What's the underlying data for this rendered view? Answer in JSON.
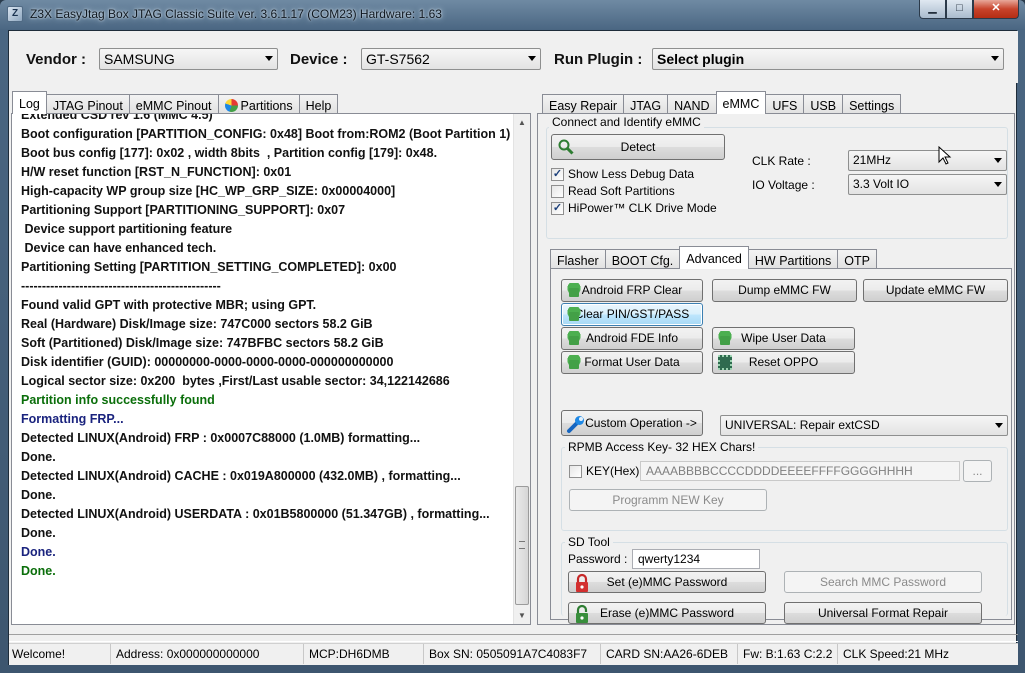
{
  "window": {
    "title": "Z3X EasyJtag Box JTAG Classic Suite ver. 3.6.1.17 (COM23) Hardware: 1.63",
    "controls": {
      "minimize": "▁",
      "maximize": "□",
      "close": "✕"
    }
  },
  "topbar": {
    "vendor_label": "Vendor :",
    "vendor_value": "SAMSUNG",
    "device_label": "Device :",
    "device_value": "GT-S7562",
    "plugin_label": "Run Plugin :",
    "plugin_value": "Select plugin"
  },
  "left_tabs": [
    "Log",
    "JTAG Pinout",
    "eMMC Pinout",
    "Partitions",
    "Help"
  ],
  "log_lines": [
    {
      "text": "Extended CSD rev 1.6 (MMC 4.5)",
      "color": "#111111"
    },
    {
      "text": "Boot configuration [PARTITION_CONFIG: 0x48] Boot from:ROM2 (Boot Partition 1)",
      "color": "#111111"
    },
    {
      "text": "Boot bus config [177]: 0x02 , width 8bits  , Partition config [179]: 0x48.",
      "color": "#111111"
    },
    {
      "text": "H/W reset function [RST_N_FUNCTION]: 0x01",
      "color": "#111111"
    },
    {
      "text": "High-capacity WP group size [HC_WP_GRP_SIZE: 0x00004000]",
      "color": "#111111"
    },
    {
      "text": "Partitioning Support [PARTITIONING_SUPPORT]: 0x07",
      "color": "#111111"
    },
    {
      "text": " Device support partitioning feature",
      "color": "#111111"
    },
    {
      "text": " Device can have enhanced tech.",
      "color": "#111111"
    },
    {
      "text": "Partitioning Setting [PARTITION_SETTING_COMPLETED]: 0x00",
      "color": "#111111"
    },
    {
      "text": "------------------------------------------------",
      "color": "#111111"
    },
    {
      "text": "Found valid GPT with protective MBR; using GPT.",
      "color": "#111111"
    },
    {
      "text": "Real (Hardware) Disk/Image size: 747C000 sectors 58.2 GiB",
      "color": "#111111"
    },
    {
      "text": "Soft (Partitioned) Disk/Image size: 747BFBC sectors 58.2 GiB",
      "color": "#111111"
    },
    {
      "text": "Disk identifier (GUID): 00000000-0000-0000-0000-000000000000",
      "color": "#111111"
    },
    {
      "text": "Logical sector size: 0x200  bytes ,First/Last usable sector: 34,122142686",
      "color": "#111111"
    },
    {
      "text": "Partition info successfully found",
      "color": "#0a6e0a"
    },
    {
      "text": "Formatting FRP...",
      "color": "#1a237e"
    },
    {
      "text": "Detected LINUX(Android) FRP : 0x0007C88000 (1.0MB) formatting...",
      "color": "#111111"
    },
    {
      "text": "Done.",
      "color": "#111111"
    },
    {
      "text": "Detected LINUX(Android) CACHE : 0x019A800000 (432.0MB) , formatting...",
      "color": "#111111"
    },
    {
      "text": "Done.",
      "color": "#111111"
    },
    {
      "text": "Detected LINUX(Android) USERDATA : 0x01B5800000 (51.347GB) , formatting...",
      "color": "#111111"
    },
    {
      "text": "Done.",
      "color": "#111111"
    },
    {
      "text": "Done.",
      "color": "#1a237e"
    },
    {
      "text": "Done.",
      "color": "#0a6e0a"
    }
  ],
  "right_tabs": [
    "Easy Repair",
    "JTAG",
    "NAND",
    "eMMC",
    "UFS",
    "USB",
    "Settings"
  ],
  "emmc": {
    "group_title": "Connect and Identify eMMC",
    "detect_label": "Detect",
    "show_less_debug": "Show Less Debug Data",
    "read_soft": "Read Soft Partitions",
    "hipower": "HiPower™ CLK Drive Mode",
    "clk_label": "CLK Rate :",
    "clk_value": "21MHz",
    "io_label": "IO Voltage :",
    "io_value": "3.3 Volt IO"
  },
  "sub_tabs": [
    "Flasher",
    "BOOT Cfg.",
    "Advanced",
    "HW Partitions",
    "OTP"
  ],
  "advanced": {
    "android_frp_clear": "Android FRP Clear",
    "dump_emmc_fw": "Dump eMMC FW",
    "update_emmc_fw": "Update eMMC FW",
    "clear_pin": "Clear PIN/GST/PASS",
    "android_fde_info": "Android FDE Info",
    "wipe_user_data": "Wipe User Data",
    "format_user_data": "Format User Data",
    "reset_oppo": "Reset OPPO",
    "custom_operation": "Custom Operation ->",
    "custom_value": "UNIVERSAL: Repair extCSD",
    "rpmb_title": "RPMB Access Key- 32 HEX Chars!",
    "key_label": "KEY(Hex) :",
    "key_value": "AAAABBBBCCCCDDDDEEEEFFFFGGGGHHHH",
    "browse": "...",
    "program_key": "Programm NEW Key",
    "sd_title": "SD Tool",
    "password_label": "Password :",
    "password_value": "qwerty1234",
    "set_password": "Set (e)MMC Password",
    "search_password": "Search MMC Password",
    "erase_password": "Erase (e)MMC Password",
    "universal_format": "Universal Format Repair"
  },
  "status": {
    "welcome": "Welcome!",
    "address": "Address: 0x000000000000",
    "mcp": "MCP:DH6DMB",
    "box_sn": "Box SN: 0505091A7C4083F7",
    "card_sn": "CARD SN:AA26-6DEB",
    "fw": "Fw: B:1.63 C:2.2",
    "clk": "CLK Speed:21 MHz"
  }
}
